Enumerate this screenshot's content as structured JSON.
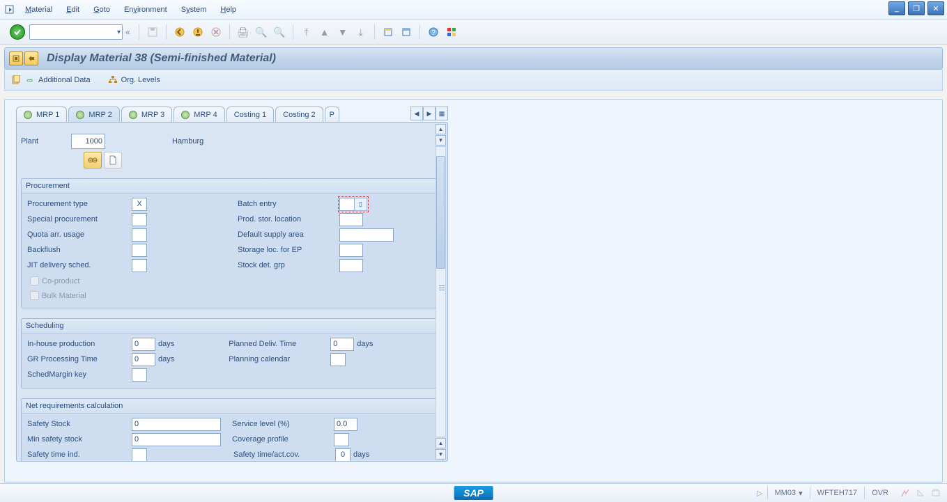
{
  "menu": {
    "items": [
      "Material",
      "Edit",
      "Goto",
      "Environment",
      "System",
      "Help"
    ]
  },
  "title": "Display Material 38 (Semi-finished Material)",
  "actions": {
    "additional_data": "Additional Data",
    "org_levels": "Org. Levels"
  },
  "tabs": {
    "items": [
      {
        "label": "MRP 1",
        "active": false
      },
      {
        "label": "MRP 2",
        "active": true
      },
      {
        "label": "MRP 3",
        "active": false
      },
      {
        "label": "MRP 4",
        "active": false
      },
      {
        "label": "Costing 1",
        "active": false
      },
      {
        "label": "Costing 2",
        "active": false
      },
      {
        "label": "P",
        "active": false
      }
    ]
  },
  "plant": {
    "label": "Plant",
    "value": "1000",
    "description": "Hamburg"
  },
  "groups": {
    "procurement": {
      "title": "Procurement",
      "left": [
        {
          "label": "Procurement type",
          "value": "X"
        },
        {
          "label": "Special procurement",
          "value": ""
        },
        {
          "label": "Quota arr. usage",
          "value": ""
        },
        {
          "label": "Backflush",
          "value": ""
        },
        {
          "label": "JIT delivery sched.",
          "value": ""
        }
      ],
      "right": [
        {
          "label": "Batch entry",
          "value": ""
        },
        {
          "label": "Prod. stor. location",
          "value": ""
        },
        {
          "label": "Default supply area",
          "value": ""
        },
        {
          "label": "Storage loc. for EP",
          "value": ""
        },
        {
          "label": "Stock det. grp",
          "value": ""
        }
      ],
      "checks": [
        {
          "label": "Co-product",
          "checked": false
        },
        {
          "label": "Bulk Material",
          "checked": false
        }
      ]
    },
    "scheduling": {
      "title": "Scheduling",
      "inhouse_label": "In-house production",
      "inhouse_value": "0",
      "inhouse_unit": "days",
      "gr_label": "GR Processing Time",
      "gr_value": "0",
      "gr_unit": "days",
      "smk_label": "SchedMargin key",
      "smk_value": "",
      "pdt_label": "Planned Deliv. Time",
      "pdt_value": "0",
      "pdt_unit": "days",
      "pc_label": "Planning calendar",
      "pc_value": ""
    },
    "netreq": {
      "title": "Net requirements calculation",
      "safety_stock_label": "Safety Stock",
      "safety_stock_value": "0",
      "min_safety_label": "Min safety stock",
      "min_safety_value": "0",
      "safety_time_ind_label": "Safety time ind.",
      "safety_time_ind_value": "",
      "service_level_label": "Service level (%)",
      "service_level_value": "0.0",
      "coverage_label": "Coverage profile",
      "coverage_value": "",
      "stact_label": "Safety time/act.cov.",
      "stact_value": "0",
      "stact_unit": "days"
    }
  },
  "status": {
    "tcode": "MM03",
    "system": "WFTEH717",
    "mode": "OVR"
  }
}
